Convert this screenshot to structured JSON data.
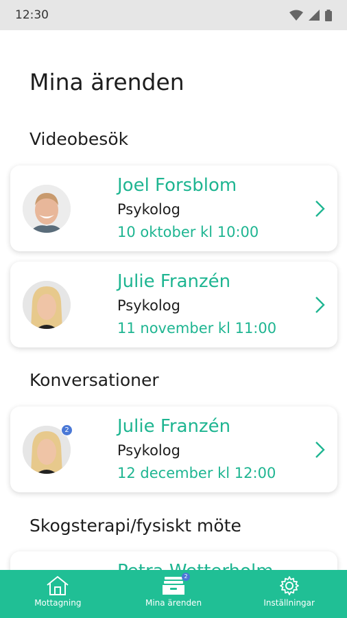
{
  "status_bar": {
    "time": "12:30"
  },
  "page_title": "Mina ärenden",
  "sections": [
    {
      "title": "Videobesök"
    },
    {
      "title": "Konversationer"
    },
    {
      "title": "Skogsterapi/fysiskt möte"
    }
  ],
  "cards": [
    {
      "name": "Joel Forsblom",
      "role": "Psykolog",
      "date": "10 oktober kl 10:00",
      "badge": ""
    },
    {
      "name": "Julie Franzén",
      "role": "Psykolog",
      "date": "11 november kl 11:00",
      "badge": ""
    },
    {
      "name": "Julie Franzén",
      "role": "Psykolog",
      "date": "12 december kl 12:00",
      "badge": "2"
    },
    {
      "name": "Petra Wetterholm"
    }
  ],
  "bottom_nav": {
    "items": [
      {
        "label": "Mottagning",
        "icon": "home-icon"
      },
      {
        "label": "Mina ärenden",
        "icon": "inbox-icon",
        "badge": "2"
      },
      {
        "label": "Inställningar",
        "icon": "gear-icon"
      }
    ]
  },
  "colors": {
    "accent": "#20bf95",
    "text_accent": "#1eb591",
    "badge": "#4a78d6"
  }
}
